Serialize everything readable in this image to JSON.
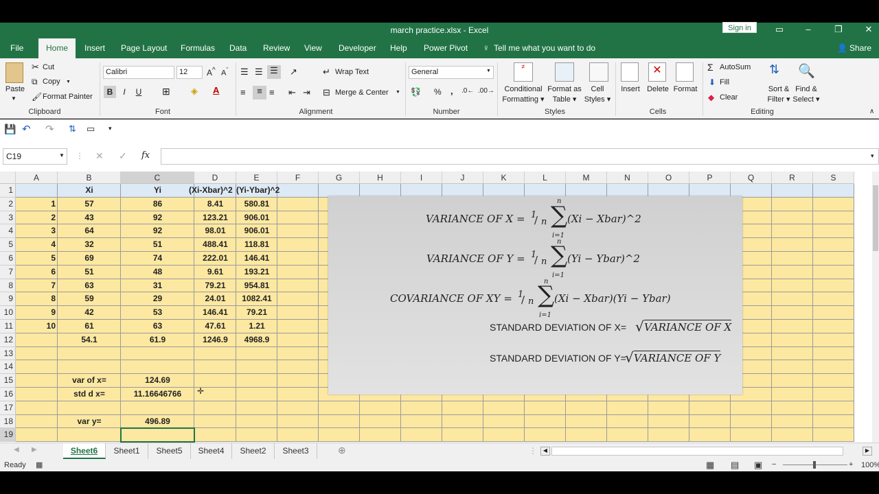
{
  "window": {
    "title": "march practice.xlsx  -  Excel",
    "signin": "Sign in"
  },
  "tabs": [
    "File",
    "Home",
    "Insert",
    "Page Layout",
    "Formulas",
    "Data",
    "Review",
    "View",
    "Developer",
    "Help",
    "Power Pivot"
  ],
  "tell_me": "Tell me what you want to do",
  "share": "Share",
  "ribbon": {
    "clipboard": {
      "paste": "Paste",
      "cut": "Cut",
      "copy": "Copy",
      "format_painter": "Format Painter",
      "label": "Clipboard"
    },
    "font": {
      "name": "Calibri",
      "size": "12",
      "bold": "B",
      "italic": "I",
      "underline": "U",
      "label": "Font"
    },
    "alignment": {
      "wrap": "Wrap Text",
      "merge": "Merge & Center",
      "label": "Alignment"
    },
    "number": {
      "format": "General",
      "label": "Number",
      "percent": "%",
      "comma": ","
    },
    "styles": {
      "conditional": "Conditional",
      "conditional2": "Formatting",
      "format_as": "Format as",
      "format_as2": "Table",
      "cell": "Cell",
      "cell2": "Styles",
      "label": "Styles"
    },
    "cells": {
      "insert": "Insert",
      "delete": "Delete",
      "format": "Format",
      "label": "Cells"
    },
    "editing": {
      "autosum": "AutoSum",
      "fill": "Fill",
      "clear": "Clear",
      "sort": "Sort &",
      "sort2": "Filter",
      "find": "Find &",
      "find2": "Select",
      "label": "Editing"
    }
  },
  "namebox": "C19",
  "columns": [
    "A",
    "B",
    "C",
    "D",
    "E",
    "F",
    "G",
    "H",
    "I",
    "J",
    "K",
    "L",
    "M",
    "N",
    "O",
    "P",
    "Q",
    "R",
    "S"
  ],
  "rows": [
    "1",
    "2",
    "3",
    "4",
    "5",
    "6",
    "7",
    "8",
    "9",
    "10",
    "11",
    "12",
    "13",
    "14",
    "15",
    "16",
    "17",
    "18",
    "19"
  ],
  "cells": {
    "header": {
      "B": "Xi",
      "C": "Yi",
      "D": "(Xi-Xbar)^2",
      "E": "(Yi-Ybar)^2"
    },
    "data": [
      {
        "A": "1",
        "B": "57",
        "C": "86",
        "D": "8.41",
        "E": "580.81"
      },
      {
        "A": "2",
        "B": "43",
        "C": "92",
        "D": "123.21",
        "E": "906.01"
      },
      {
        "A": "3",
        "B": "64",
        "C": "92",
        "D": "98.01",
        "E": "906.01"
      },
      {
        "A": "4",
        "B": "32",
        "C": "51",
        "D": "488.41",
        "E": "118.81"
      },
      {
        "A": "5",
        "B": "69",
        "C": "74",
        "D": "222.01",
        "E": "146.41"
      },
      {
        "A": "6",
        "B": "51",
        "C": "48",
        "D": "9.61",
        "E": "193.21"
      },
      {
        "A": "7",
        "B": "63",
        "C": "31",
        "D": "79.21",
        "E": "954.81"
      },
      {
        "A": "8",
        "B": "59",
        "C": "29",
        "D": "24.01",
        "E": "1082.41"
      },
      {
        "A": "9",
        "B": "42",
        "C": "53",
        "D": "146.41",
        "E": "79.21"
      },
      {
        "A": "10",
        "B": "61",
        "C": "63",
        "D": "47.61",
        "E": "1.21"
      }
    ],
    "totals": {
      "B": "54.1",
      "C": "61.9",
      "D": "1246.9",
      "E": "4968.9"
    },
    "var_x_label": "var of x=",
    "var_x": "124.69",
    "std_x_label": "std d x=",
    "std_x": "11.16646766",
    "var_y_label": "var y=",
    "var_y": "496.89"
  },
  "equations": {
    "var_x_lhs": "VARIANCE OF X = ",
    "var_x_rhs": "(Xi − Xbar)^2",
    "var_y_lhs": "VARIANCE OF Y = ",
    "var_y_rhs": "(Yi − Ybar)^2",
    "cov_lhs": "COVARIANCE OF XY = ",
    "cov_rhs": "(Xi − Xbar)(Yi − Ybar)",
    "frac_num": "1",
    "frac_den": "n",
    "sum_top": "n",
    "sum_bot": "i=1",
    "sd_x_label": "STANDARD DEVIATION OF X=",
    "sd_x_arg": "VARIANCE OF X",
    "sd_y_label": "STANDARD DEVIATION OF Y=",
    "sd_y_arg": "VARIANCE OF Y"
  },
  "sheets": [
    "Sheet6",
    "Sheet1",
    "Sheet5",
    "Sheet4",
    "Sheet2",
    "Sheet3"
  ],
  "status": {
    "ready": "Ready",
    "zoom": "100%"
  }
}
